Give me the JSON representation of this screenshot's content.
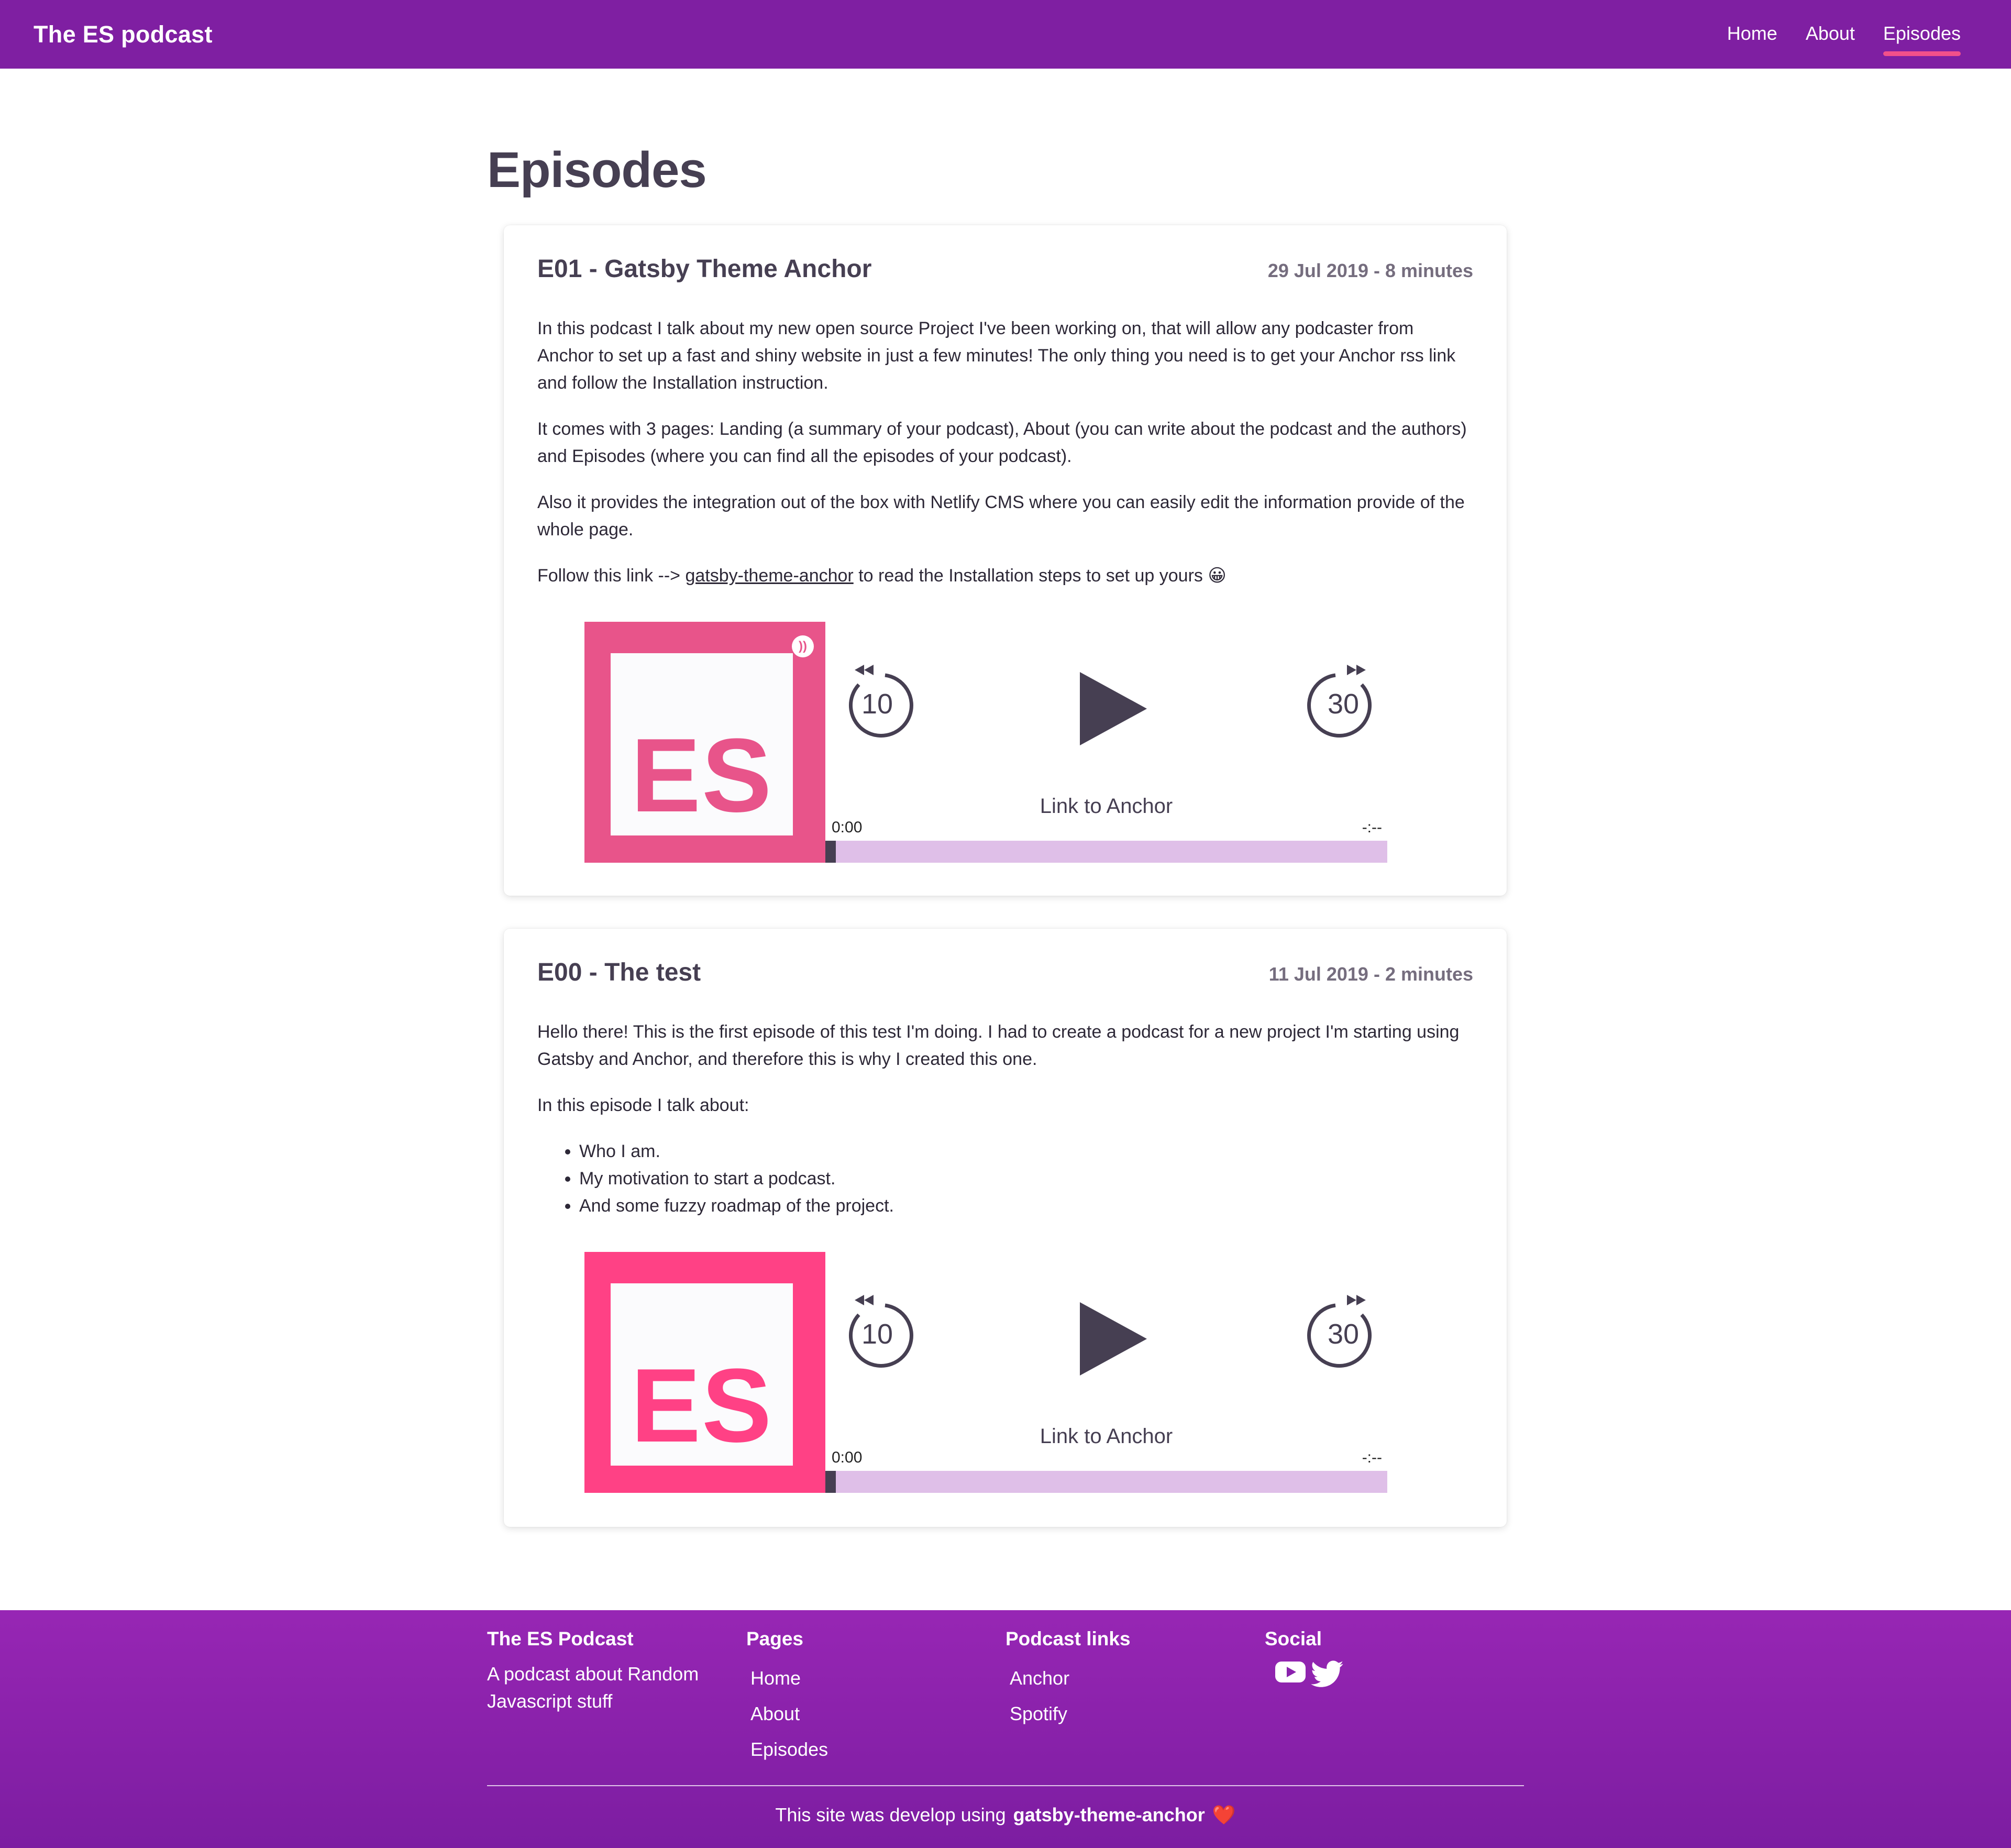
{
  "header": {
    "brand": "The ES podcast",
    "nav": [
      {
        "label": "Home"
      },
      {
        "label": "About"
      },
      {
        "label": "Episodes",
        "active": true
      }
    ],
    "bg_color": "#7f1fa2",
    "accent_color": "#f2508a"
  },
  "main": {
    "title": "Episodes",
    "episodes": [
      {
        "title": "E01 - Gatsby Theme Anchor",
        "meta": "29 Jul 2019 - 8 minutes",
        "paragraphs": [
          "In this podcast I talk about my new open source Project I've been working on, that will allow any podcaster from Anchor to set up a fast and shiny website in just a few minutes! The only thing you need is to get your Anchor rss link and follow the Installation instruction.",
          "It comes with 3 pages: Landing (a summary of your podcast), About (you can write about the podcast and the authors) and Episodes (where you can find all the episodes of your podcast).",
          "Also it provides the integration out of the box with Netlify CMS where you can easily edit the information provide of the whole page."
        ],
        "follow_prefix": "Follow this link --> ",
        "follow_link": "gatsby-theme-anchor",
        "follow_suffix": " to read the Installation steps to set up yours 😀",
        "player": {
          "cover_text": "ES",
          "back_label": "10",
          "forward_label": "30",
          "link_label": "Link to Anchor",
          "time_start": "0:00",
          "time_end": "-:--",
          "progress": 0
        }
      },
      {
        "title": "E00 - The test",
        "meta": "11 Jul 2019 - 2 minutes",
        "paragraphs": [
          "Hello there! This is the first episode of this test I'm doing. I had to create a podcast for a new project I'm starting using Gatsby and Anchor, and therefore this is why I created this one.",
          "In this episode I talk about:"
        ],
        "bullets": [
          "Who I am.",
          "My motivation to start a podcast.",
          "And some fuzzy roadmap of the project."
        ],
        "player": {
          "cover_text": "ES",
          "back_label": "10",
          "forward_label": "30",
          "link_label": "Link to Anchor",
          "time_start": "0:00",
          "time_end": "-:--",
          "progress": 0
        }
      }
    ]
  },
  "footer": {
    "about_heading": "The ES Podcast",
    "about_text": "A podcast about Random Javascript stuff",
    "pages_heading": "Pages",
    "pages": [
      "Home",
      "About",
      "Episodes"
    ],
    "podcast_heading": "Podcast links",
    "podcast_links": [
      "Anchor",
      "Spotify"
    ],
    "social_heading": "Social",
    "social_icons": [
      "youtube-icon",
      "twitter-icon"
    ],
    "credits_prefix": "This site was develop using",
    "credits_link": "gatsby-theme-anchor",
    "credits_heart": "❤️"
  }
}
